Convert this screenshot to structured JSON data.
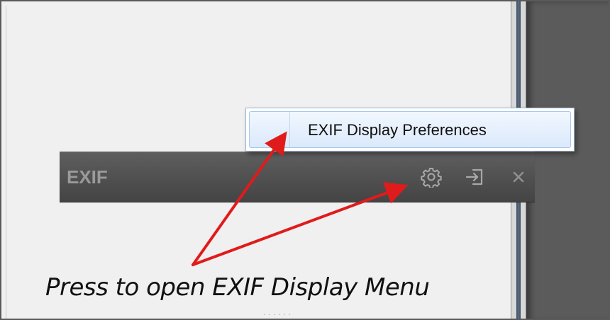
{
  "context_menu": {
    "items": [
      {
        "label": "EXIF Display Preferences"
      }
    ]
  },
  "exif_panel": {
    "title": "EXIF",
    "icons": {
      "settings": "gear-icon",
      "undock": "undock-icon",
      "close": "close-icon"
    }
  },
  "annotation": {
    "caption": "Press to open EXIF Display Menu",
    "arrow_color": "#e01b1b"
  },
  "colors": {
    "panel_header": "#4f4f4f",
    "menu_highlight": "#dbe9fb",
    "right_pane": "#5b5b5b"
  }
}
